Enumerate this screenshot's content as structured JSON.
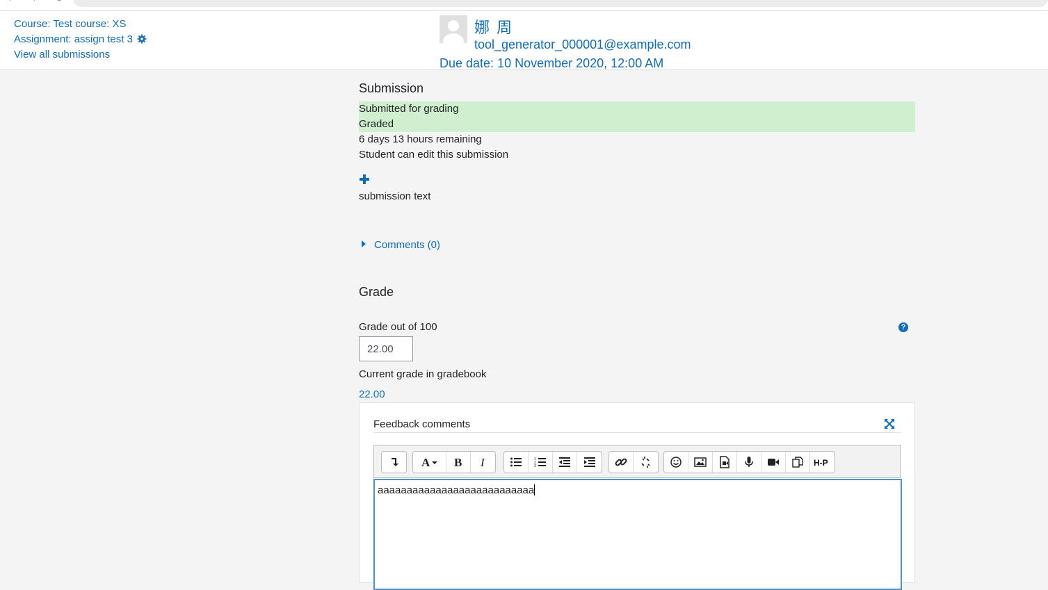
{
  "header": {
    "course_link": "Course: Test course: XS",
    "assignment_link": "Assignment: assign test 3",
    "view_all_link": "View all submissions",
    "user_name": "娜 周",
    "user_email": "tool_generator_000001@example.com",
    "due_date": "Due date: 10 November 2020, 12:00 AM"
  },
  "submission": {
    "title": "Submission",
    "status_submitted": "Submitted for grading",
    "status_graded": "Graded",
    "time_remaining": "6 days 13 hours remaining",
    "edit_note": "Student can edit this submission",
    "submission_text": "submission text",
    "comments_label": "Comments (0)"
  },
  "grade": {
    "title": "Grade",
    "grade_label": "Grade out of 100",
    "grade_value": "22.00",
    "current_label": "Current grade in gradebook",
    "current_value": "22.00",
    "help_symbol": "?"
  },
  "feedback": {
    "label": "Feedback comments",
    "text": "aaaaaaaaaaaaaaaaaaaaaaaaaaa",
    "toolbar_icons": [
      "show-more-icon",
      "font-style-icon",
      "bold-icon",
      "italic-icon",
      "unordered-list-icon",
      "ordered-list-icon",
      "outdent-icon",
      "indent-icon",
      "link-icon",
      "unlink-icon",
      "emoji-icon",
      "image-icon",
      "media-icon",
      "record-audio-icon",
      "record-video-icon",
      "manage-files-icon",
      "h5p-icon"
    ]
  },
  "colors": {
    "link": "#0f6cbf",
    "status_green": "#cfefcf",
    "page_bg": "#f4f4f4"
  }
}
